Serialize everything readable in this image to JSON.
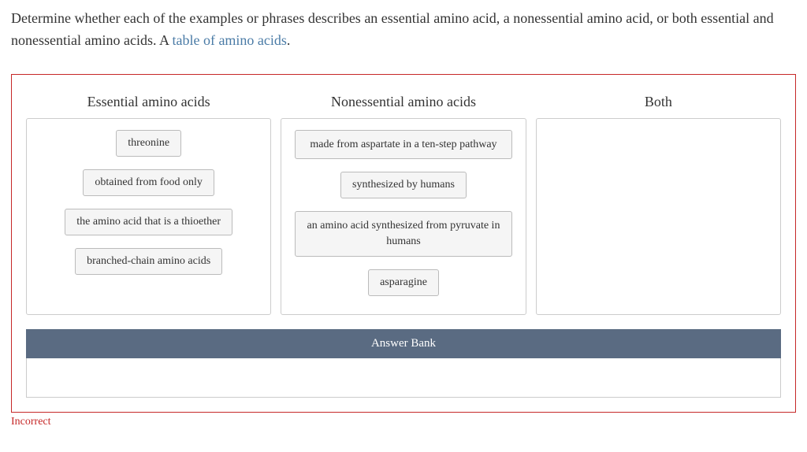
{
  "question": {
    "prefix": "Determine whether each of the examples or phrases describes an essential amino acid, a nonessential amino acid, or both essential and nonessential amino acids. A ",
    "link_text": "table of amino acids",
    "suffix": "."
  },
  "columns": {
    "essential": {
      "title": "Essential amino acids",
      "items": [
        "threonine",
        "obtained from food only",
        "the amino acid that is a thioether",
        "branched-chain amino acids"
      ]
    },
    "nonessential": {
      "title": "Nonessential amino acids",
      "items": [
        "made from aspartate in a ten-step pathway",
        "synthesized by humans",
        "an amino acid synthesized from pyruvate in humans",
        "asparagine"
      ]
    },
    "both": {
      "title": "Both",
      "items": []
    }
  },
  "answer_bank": {
    "label": "Answer Bank"
  },
  "feedback": "Incorrect"
}
